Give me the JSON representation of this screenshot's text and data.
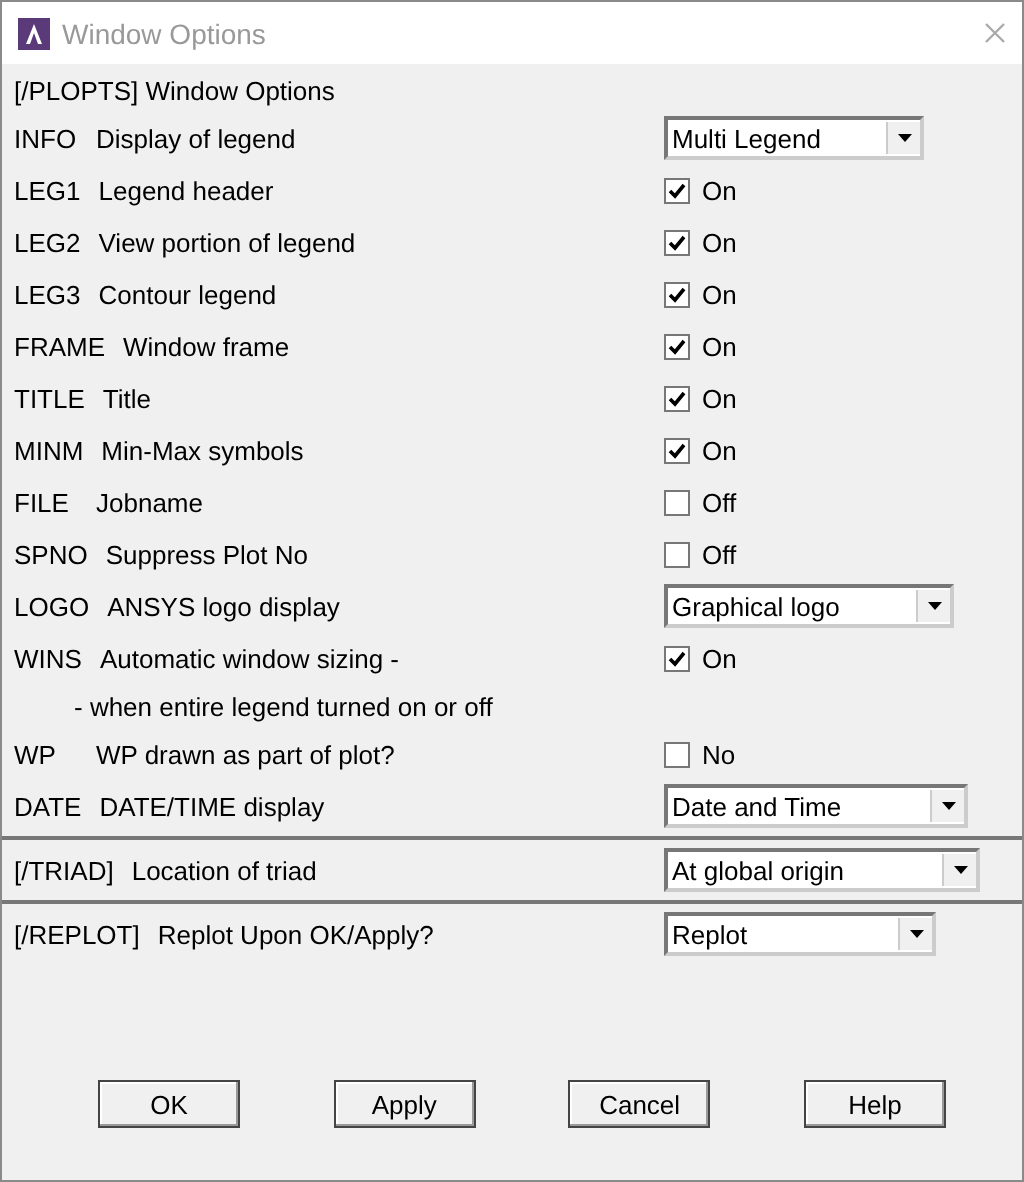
{
  "window": {
    "title": "Window Options"
  },
  "sections": [
    {
      "heading": "[/PLOPTS]  Window Options",
      "rows": [
        {
          "code": "INFO",
          "label": "Display of legend",
          "kind": "dropdown",
          "value": "Multi Legend"
        },
        {
          "code": "LEG1",
          "label": "Legend header",
          "kind": "checkbox",
          "checked": true,
          "value": "On"
        },
        {
          "code": "LEG2",
          "label": "View portion of legend",
          "kind": "checkbox",
          "checked": true,
          "value": "On"
        },
        {
          "code": "LEG3",
          "label": "Contour legend",
          "kind": "checkbox",
          "checked": true,
          "value": "On"
        },
        {
          "code": "FRAME",
          "label": "Window frame",
          "kind": "checkbox",
          "checked": true,
          "value": "On"
        },
        {
          "code": "TITLE",
          "label": "Title",
          "kind": "checkbox",
          "checked": true,
          "value": "On"
        },
        {
          "code": "MINM",
          "label": "Min-Max symbols",
          "kind": "checkbox",
          "checked": true,
          "value": "On"
        },
        {
          "code": "FILE",
          "label": "Jobname",
          "kind": "checkbox",
          "checked": false,
          "value": "Off"
        },
        {
          "code": "SPNO",
          "label": "Suppress Plot No",
          "kind": "checkbox",
          "checked": false,
          "value": "Off"
        },
        {
          "code": "LOGO",
          "label": "ANSYS logo display",
          "kind": "dropdown",
          "value": "Graphical logo"
        },
        {
          "code": "WINS",
          "label": "Automatic window sizing -",
          "kind": "checkbox",
          "checked": true,
          "value": "On"
        },
        {
          "kind": "note",
          "label": "- when entire legend turned on or off"
        },
        {
          "code": "WP",
          "label": "WP drawn as part of plot?",
          "kind": "checkbox",
          "checked": false,
          "value": "No"
        },
        {
          "code": "DATE",
          "label": "DATE/TIME display",
          "kind": "dropdown",
          "value": "Date and Time"
        }
      ]
    },
    {
      "rows": [
        {
          "code": "[/TRIAD]",
          "label": "Location of triad",
          "kind": "dropdown",
          "value": "At global origin"
        }
      ]
    },
    {
      "rows": [
        {
          "code": "[/REPLOT]",
          "label": "Replot Upon OK/Apply?",
          "kind": "dropdown",
          "value": "Replot"
        }
      ]
    }
  ],
  "buttons": [
    "OK",
    "Apply",
    "Cancel",
    "Help"
  ]
}
